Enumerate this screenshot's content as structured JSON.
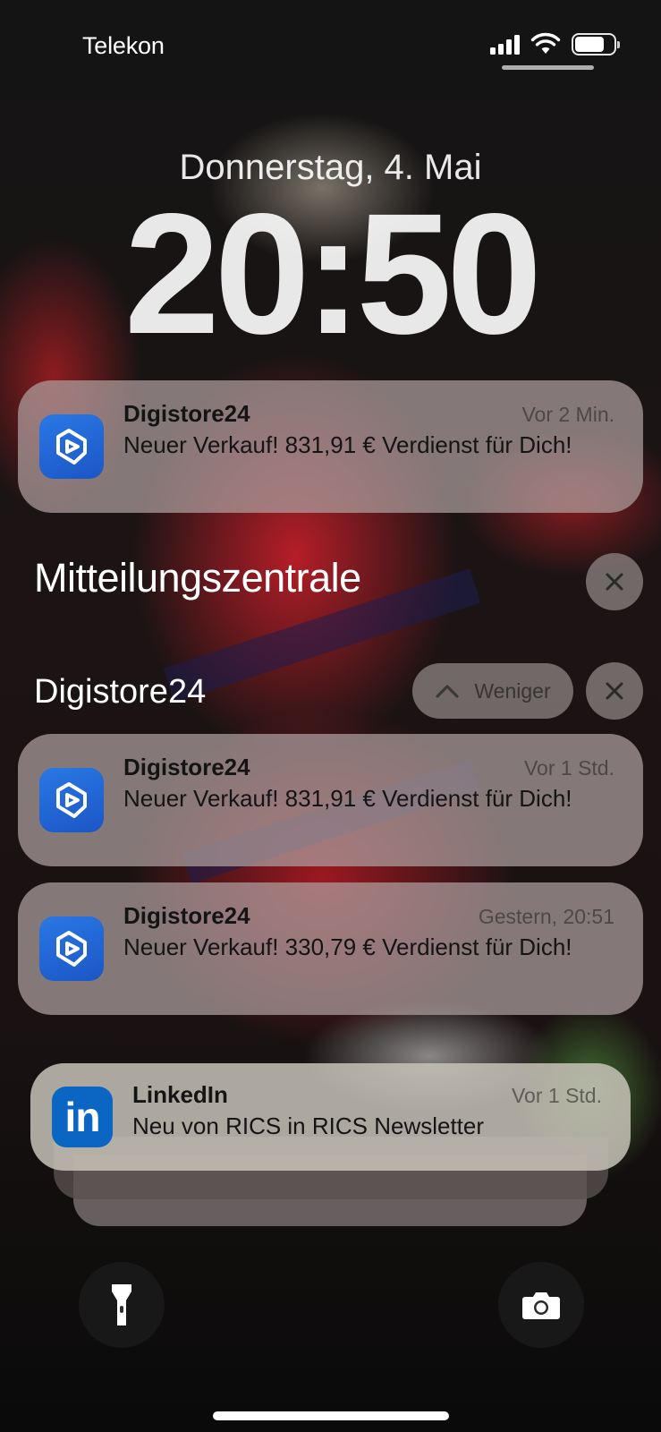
{
  "status_bar": {
    "carrier": "Telekon",
    "signal_bars": 4,
    "battery_level": 0.75
  },
  "lock_screen": {
    "date": "Donnerstag, 4. Mai",
    "time": "20:50"
  },
  "top_notification": {
    "app": "Digistore24",
    "time": "Vor 2 Min.",
    "message": "Neuer Verkauf! 831,91 € Verdienst für Dich!"
  },
  "notification_center": {
    "title": "Mitteilungszentrale",
    "group": {
      "title": "Digistore24",
      "less_label": "Weniger",
      "notifications": [
        {
          "app": "Digistore24",
          "time": "Vor 1 Std.",
          "message": "Neuer Verkauf! 831,91 € Verdienst für Dich!"
        },
        {
          "app": "Digistore24",
          "time": "Gestern, 20:51",
          "message": "Neuer Verkauf! 330,79 € Verdienst für Dich!"
        }
      ]
    },
    "linkedin": {
      "app": "LinkedIn",
      "time": "Vor 1 Std.",
      "message": "Neu von RICS in RICS Newsletter",
      "icon_text": "in"
    }
  },
  "colors": {
    "digistore_icon": "#2a78e4",
    "linkedin_icon": "#0a66c2"
  },
  "icons": [
    "flashlight-icon",
    "camera-icon",
    "close-icon",
    "chevron-up-icon",
    "wifi-icon",
    "battery-icon",
    "signal-icon"
  ]
}
